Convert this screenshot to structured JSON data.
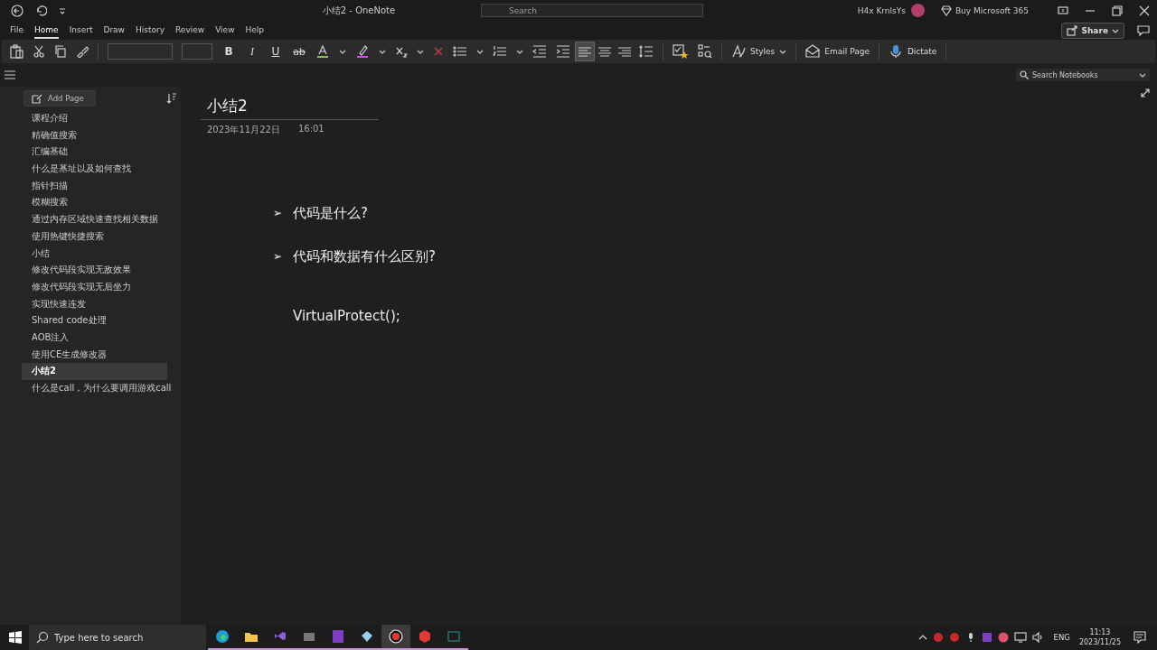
{
  "window": {
    "title": "小结2  -  OneNote",
    "search": {
      "placeholder": "Search"
    },
    "user": "H4x KrnlsYs",
    "buy": "Buy Microsoft 365"
  },
  "menu_tabs": [
    {
      "label": "File",
      "selected": false
    },
    {
      "label": "Home",
      "selected": true
    },
    {
      "label": "Insert",
      "selected": false
    },
    {
      "label": "Draw",
      "selected": false
    },
    {
      "label": "History",
      "selected": false
    },
    {
      "label": "Review",
      "selected": false
    },
    {
      "label": "View",
      "selected": false
    },
    {
      "label": "Help",
      "selected": false
    }
  ],
  "share": "Share",
  "format_buttons": [
    {
      "kind": "bold",
      "label": "B"
    },
    {
      "kind": "italic",
      "label": "I"
    },
    {
      "kind": "underline",
      "label": "U"
    },
    {
      "kind": "strike",
      "label": "ab"
    }
  ],
  "alignment": [
    {
      "selected": true
    },
    {
      "selected": false
    },
    {
      "selected": false
    }
  ],
  "ribbon_buttons": [
    {
      "kind": "styles",
      "label": "Styles"
    },
    {
      "kind": "email",
      "label": "Email Page"
    },
    {
      "kind": "dictate",
      "label": "Dictate"
    }
  ],
  "search_notebooks": {
    "placeholder": "Search Notebooks"
  },
  "add_page": "Add Page",
  "pages": [
    {
      "title": "课程介绍",
      "selected": false
    },
    {
      "title": "精确值搜索",
      "selected": false
    },
    {
      "title": "汇编基础",
      "selected": false
    },
    {
      "title": "什么是基址以及如何查找",
      "selected": false
    },
    {
      "title": "指针扫描",
      "selected": false
    },
    {
      "title": "模糊搜索",
      "selected": false
    },
    {
      "title": "通过内存区域快速查找相关数据",
      "selected": false
    },
    {
      "title": "使用热键快捷搜索",
      "selected": false
    },
    {
      "title": "小结",
      "selected": false
    },
    {
      "title": "修改代码段实现无敌效果",
      "selected": false
    },
    {
      "title": "修改代码段实现无后坐力",
      "selected": false
    },
    {
      "title": "实现快速连发",
      "selected": false
    },
    {
      "title": "Shared code处理",
      "selected": false
    },
    {
      "title": "AOB注入",
      "selected": false
    },
    {
      "title": "使用CE生成修改器",
      "selected": false
    },
    {
      "title": "小结2",
      "selected": true
    },
    {
      "title": "什么是call，为什么要调用游戏call",
      "selected": false
    }
  ],
  "note": {
    "title": "小结2",
    "date": "2023年11月22日",
    "time": "16:01",
    "lines": [
      {
        "kind": "bullet",
        "bullet": "➢",
        "text": "代码是什么?"
      },
      {
        "kind": "bullet",
        "bullet": "➢",
        "text": "代码和数据有什么区别?"
      },
      {
        "kind": "plain",
        "text": "VirtualProtect();"
      }
    ]
  },
  "taskbar": {
    "search": {
      "placeholder": "Type here to search"
    },
    "apps": [
      {
        "selected": false
      },
      {
        "selected": false
      },
      {
        "selected": false
      },
      {
        "selected": false
      },
      {
        "selected": false
      },
      {
        "selected": false
      },
      {
        "selected": true
      },
      {
        "selected": false
      },
      {
        "selected": false
      }
    ],
    "language": "ENG",
    "time": "11:13",
    "date": "2023/11/25"
  }
}
